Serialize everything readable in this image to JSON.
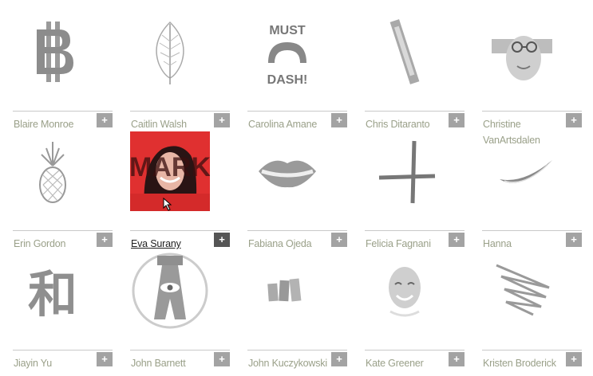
{
  "artists": [
    {
      "name": "Blaire Monroe",
      "icon": "baht-symbol-icon",
      "plus": "+"
    },
    {
      "name": "Caitlin Walsh",
      "icon": "leaf-icon",
      "plus": "+"
    },
    {
      "name": "Carolina Amane",
      "icon": "must-dash-mustache-icon",
      "artwork_text": [
        "MUST",
        "DASH!"
      ],
      "plus": "+"
    },
    {
      "name": "Chris Ditaranto",
      "icon": "tilted-stick-icon",
      "plus": "+"
    },
    {
      "name": "Christine VanArtsdalen",
      "icon": "face-with-glasses-icon",
      "plus": "+"
    },
    {
      "name": "Erin Gordon",
      "icon": "pineapple-icon",
      "plus": "+"
    },
    {
      "name": "Eva Surany",
      "icon": "portrait-photo-icon",
      "artwork_text": [
        "MARK"
      ],
      "plus": "+",
      "active": true,
      "accent": "#e03030"
    },
    {
      "name": "Fabiana Ojeda",
      "icon": "lips-icon",
      "plus": "+"
    },
    {
      "name": "Felicia Fagnani",
      "icon": "cross-strokes-icon",
      "plus": "+"
    },
    {
      "name": "Hanna",
      "icon": "brush-swoosh-icon",
      "plus": "+"
    },
    {
      "name": "Jiayin Yu",
      "icon": "chinese-character-icon",
      "artwork_text": [
        "和"
      ],
      "plus": "+"
    },
    {
      "name": "John Barnett",
      "icon": "eye-emblem-icon",
      "plus": "+"
    },
    {
      "name": "John Kuczykowski",
      "icon": "paper-strips-icon",
      "plus": "+"
    },
    {
      "name": "Kate Greener",
      "icon": "smiling-face-icon",
      "plus": "+"
    },
    {
      "name": "Kristen Broderick",
      "icon": "scribble-icon",
      "plus": "+"
    }
  ]
}
